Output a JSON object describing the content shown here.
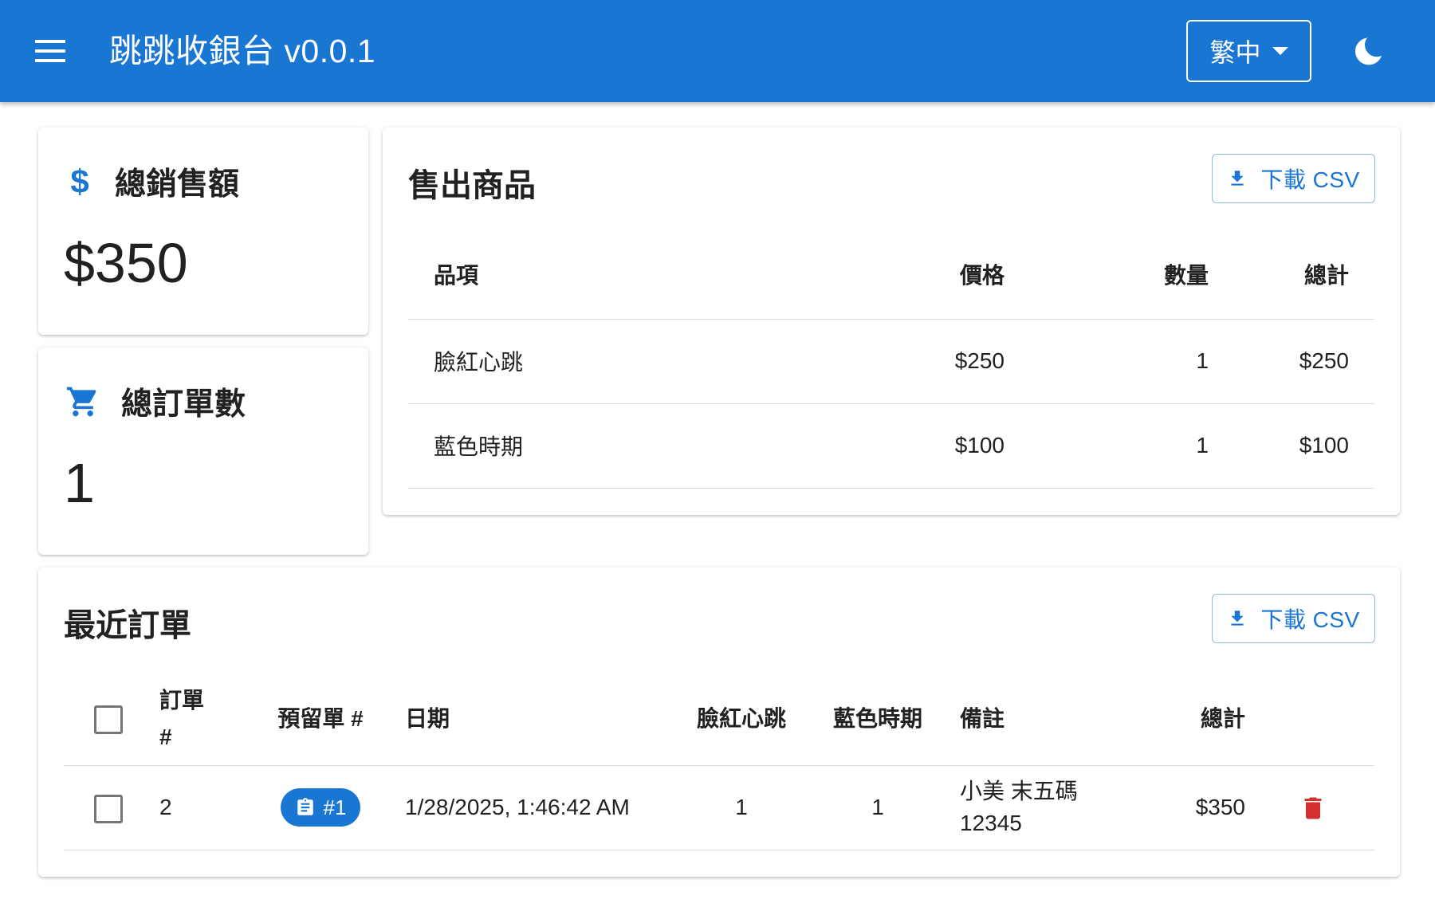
{
  "header": {
    "title": "跳跳收銀台 v0.0.1",
    "language": "繁中"
  },
  "stats": {
    "total_sales": {
      "label": "總銷售額",
      "value": "$350"
    },
    "total_orders": {
      "label": "總訂單數",
      "value": "1"
    }
  },
  "sold_items": {
    "title": "售出商品",
    "download_label": "下載 CSV",
    "columns": [
      "品項",
      "價格",
      "數量",
      "總計"
    ],
    "rows": [
      {
        "item": "臉紅心跳",
        "price": "$250",
        "qty": "1",
        "total": "$250"
      },
      {
        "item": "藍色時期",
        "price": "$100",
        "qty": "1",
        "total": "$100"
      }
    ]
  },
  "recent_orders": {
    "title": "最近訂單",
    "download_label": "下載 CSV",
    "columns": [
      "訂單 #",
      "預留單 #",
      "日期",
      "臉紅心跳",
      "藍色時期",
      "備註",
      "總計"
    ],
    "rows": [
      {
        "order": "2",
        "reservation": "#1",
        "date": "1/28/2025, 1:46:42 AM",
        "item1": "1",
        "item2": "1",
        "note": "小美 末五碼 12345",
        "total": "$350"
      }
    ]
  },
  "colors": {
    "primary": "#1976d2",
    "delete": "#d32f2f"
  }
}
